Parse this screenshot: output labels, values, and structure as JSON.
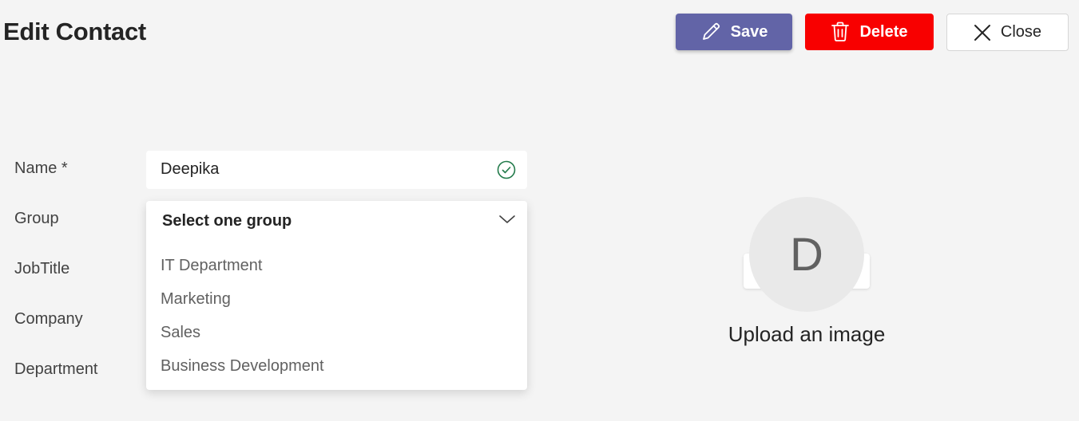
{
  "header": {
    "title": "Edit Contact",
    "save_label": "Save",
    "delete_label": "Delete",
    "close_label": "Close"
  },
  "form": {
    "name_label": "Name *",
    "name_value": "Deepika",
    "group_label": "Group",
    "jobtitle_label": "JobTitle",
    "company_label": "Company",
    "department_label": "Department"
  },
  "group_dropdown": {
    "selected": "Select one group",
    "options": [
      "IT Department",
      "Marketing",
      "Sales",
      "Business Development"
    ]
  },
  "image": {
    "avatar_initial": "D",
    "upload_label": "Upload an image"
  },
  "icons": {
    "save": "pencil-icon",
    "delete": "trash-icon",
    "close": "close-icon",
    "valid": "check-circle-icon",
    "expand": "chevron-down-icon"
  },
  "colors": {
    "save_button": "#6264a7",
    "delete_button": "#f80000",
    "valid_check": "#237b4b"
  }
}
